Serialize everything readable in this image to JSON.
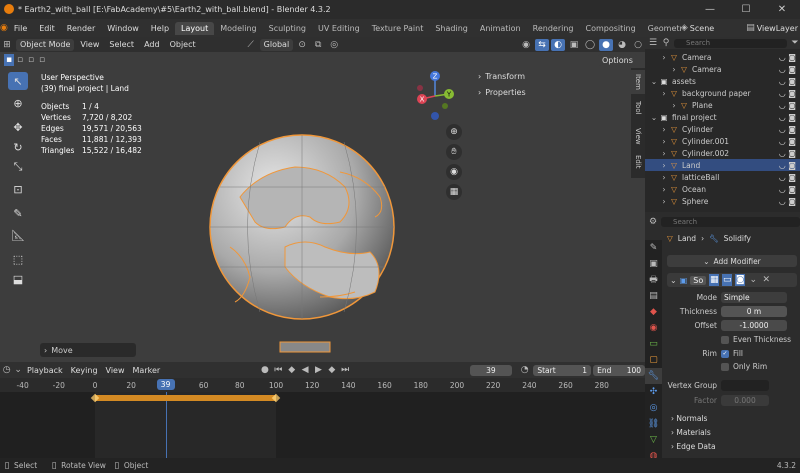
{
  "window": {
    "title": "* Earth2_with_ball [E:\\FabAcademy\\#5\\Earth2_with_ball.blend] - Blender 4.3.2",
    "min": "—",
    "max": "☐",
    "close": "✕"
  },
  "menu": [
    "File",
    "Edit",
    "Render",
    "Window",
    "Help"
  ],
  "workspaces": [
    "Layout",
    "Modeling",
    "Sculpting",
    "UV Editing",
    "Texture Paint",
    "Shading",
    "Animation",
    "Rendering",
    "Compositing",
    "Geometry Node"
  ],
  "scene": "Scene",
  "view_layer": "ViewLayer",
  "header": {
    "mode": "Object Mode",
    "items": [
      "View",
      "Select",
      "Add",
      "Object"
    ],
    "orientation": "Global",
    "options": "Options"
  },
  "viewport": {
    "perspective": "User Perspective",
    "context": "(39) final project | Land",
    "stats": [
      {
        "k": "Objects",
        "v": "1 / 4"
      },
      {
        "k": "Vertices",
        "v": "7,720 / 8,202"
      },
      {
        "k": "Edges",
        "v": "19,571 / 20,563"
      },
      {
        "k": "Faces",
        "v": "11,881 / 12,393"
      },
      {
        "k": "Triangles",
        "v": "15,522 / 16,482"
      }
    ],
    "panels": [
      "Transform",
      "Properties"
    ],
    "sidetabs": [
      "Item",
      "Tool",
      "View",
      "Edit"
    ],
    "operator": "Move",
    "gizmo": {
      "z": "Z",
      "y": "Y",
      "x": "X"
    }
  },
  "outliner": {
    "search_placeholder": "Search",
    "rows": [
      {
        "name": "Camera",
        "indent": 1
      },
      {
        "name": "Camera",
        "indent": 2
      },
      {
        "name": "assets",
        "indent": 0
      },
      {
        "name": "background paper",
        "indent": 1
      },
      {
        "name": "Plane",
        "indent": 2
      },
      {
        "name": "final project",
        "indent": 0
      },
      {
        "name": "Cylinder",
        "indent": 1
      },
      {
        "name": "Cylinder.001",
        "indent": 1
      },
      {
        "name": "Cylinder.002",
        "indent": 1
      },
      {
        "name": "Land",
        "indent": 1
      },
      {
        "name": "latticeBall",
        "indent": 1
      },
      {
        "name": "Ocean",
        "indent": 1
      },
      {
        "name": "Sphere",
        "indent": 1
      }
    ]
  },
  "properties": {
    "search_placeholder": "Search",
    "breadcrumb_obj": "Land",
    "breadcrumb_mod": "Solidify",
    "add_modifier": "Add Modifier",
    "mod_name": "So",
    "mode_label": "Mode",
    "mode_value": "Simple",
    "thickness_label": "Thickness",
    "thickness_value": "0 m",
    "offset_label": "Offset",
    "offset_value": "-1.0000",
    "even_label": "Even Thickness",
    "rim_label": "Rim",
    "fill_label": "Fill",
    "only_rim_label": "Only Rim",
    "vgroup_label": "Vertex Group",
    "factor_label": "Factor",
    "factor_value": "0.000",
    "sections": [
      "Normals",
      "Materials",
      "Edge Data"
    ]
  },
  "timeline": {
    "menus": [
      "Playback",
      "Keying",
      "View",
      "Marker"
    ],
    "current": "39",
    "start_label": "Start",
    "start": "1",
    "end_label": "End",
    "end": "100",
    "ruler": [
      {
        "v": "-40",
        "p": -40
      },
      {
        "v": "-20",
        "p": -20
      },
      {
        "v": "0",
        "p": 0
      },
      {
        "v": "20",
        "p": 20
      },
      {
        "v": "40",
        "p": 40
      },
      {
        "v": "60",
        "p": 60
      },
      {
        "v": "80",
        "p": 80
      },
      {
        "v": "100",
        "p": 100
      },
      {
        "v": "120",
        "p": 120
      },
      {
        "v": "140",
        "p": 140
      },
      {
        "v": "160",
        "p": 160
      },
      {
        "v": "180",
        "p": 180
      },
      {
        "v": "200",
        "p": 200
      },
      {
        "v": "220",
        "p": 220
      },
      {
        "v": "240",
        "p": 240
      },
      {
        "v": "260",
        "p": 260
      },
      {
        "v": "280",
        "p": 280
      }
    ],
    "keyframes": [
      0,
      100
    ]
  },
  "statusbar": {
    "select": "Select",
    "rotate": "Rotate View",
    "object": "Object",
    "version": "4.3.2"
  },
  "colors": {
    "accent": "#4772b3",
    "selected_outline": "#f0973a",
    "viewport_bg": "#3d3d3d"
  }
}
